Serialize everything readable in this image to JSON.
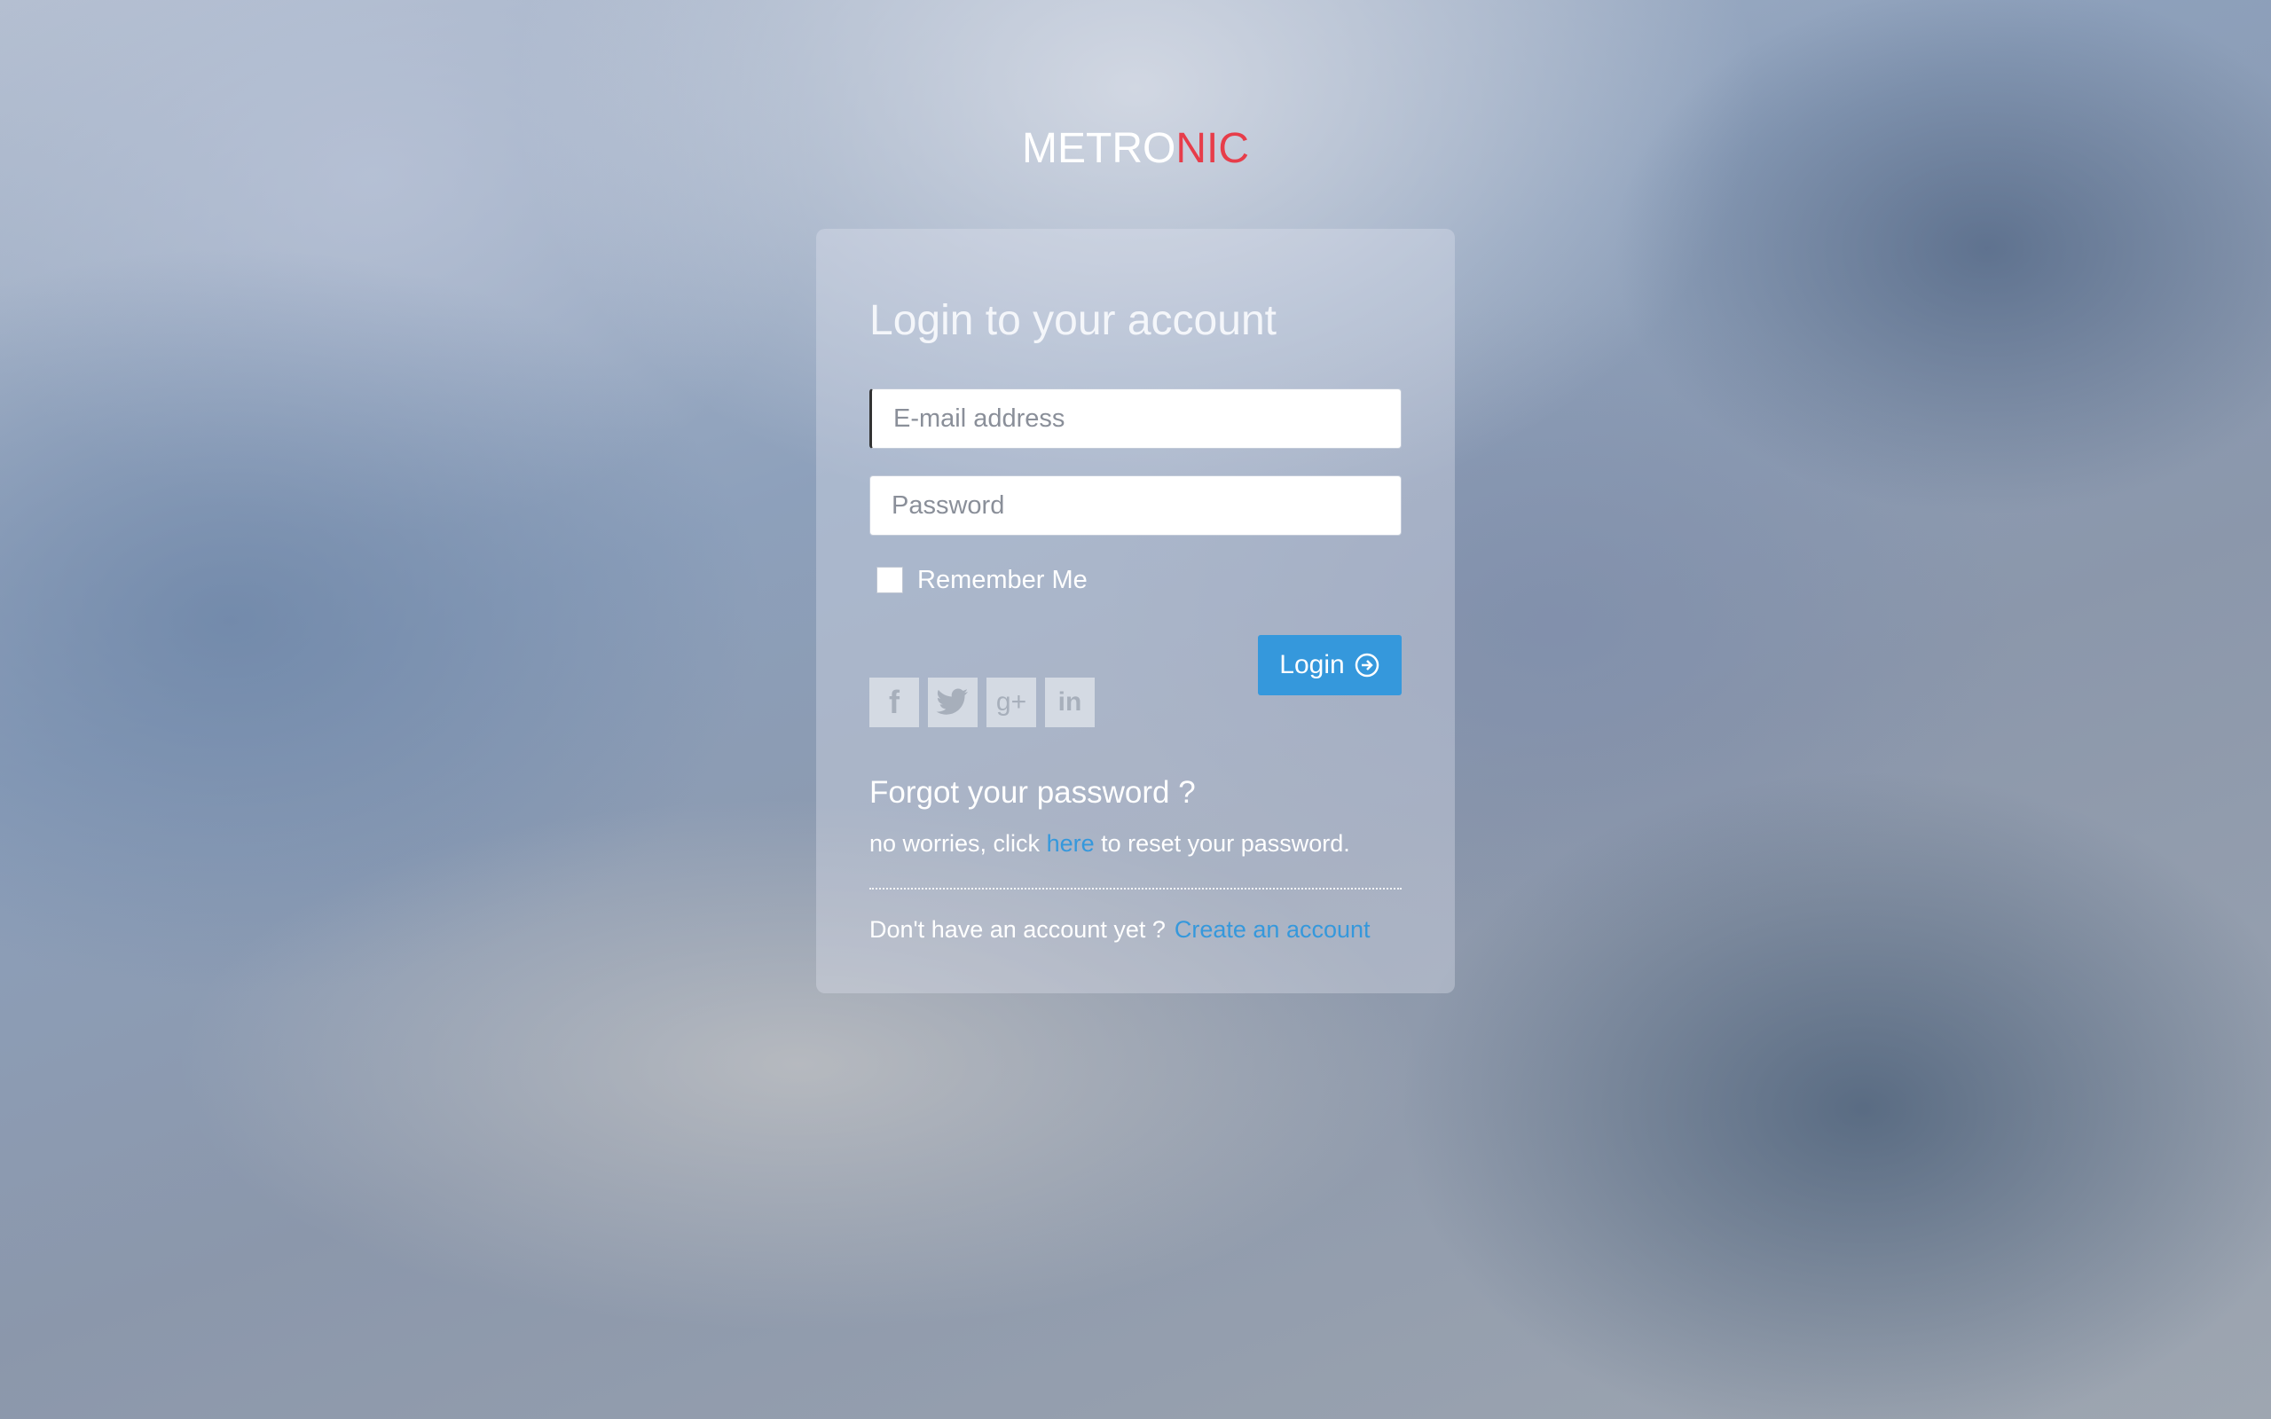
{
  "logo": {
    "part1": "METRO",
    "part2": "NIC",
    "accent_color": "#e73d4a"
  },
  "login": {
    "title": "Login to your account",
    "email_placeholder": "E-mail address",
    "password_placeholder": "Password",
    "remember_label": "Remember Me",
    "login_button": "Login",
    "login_icon": "arrow-circle-right-icon"
  },
  "social": [
    {
      "name": "facebook",
      "glyph": "f"
    },
    {
      "name": "twitter",
      "glyph": "t"
    },
    {
      "name": "google-plus",
      "glyph": "g+"
    },
    {
      "name": "linkedin",
      "glyph": "in"
    }
  ],
  "forgot": {
    "title": "Forgot your password ?",
    "text_before": "no worries, click",
    "link": "here",
    "text_after": "to reset your password."
  },
  "signup": {
    "text": "Don't have an account yet ?",
    "link": "Create an account"
  },
  "colors": {
    "button": "#3598dc",
    "link": "#3598dc"
  }
}
